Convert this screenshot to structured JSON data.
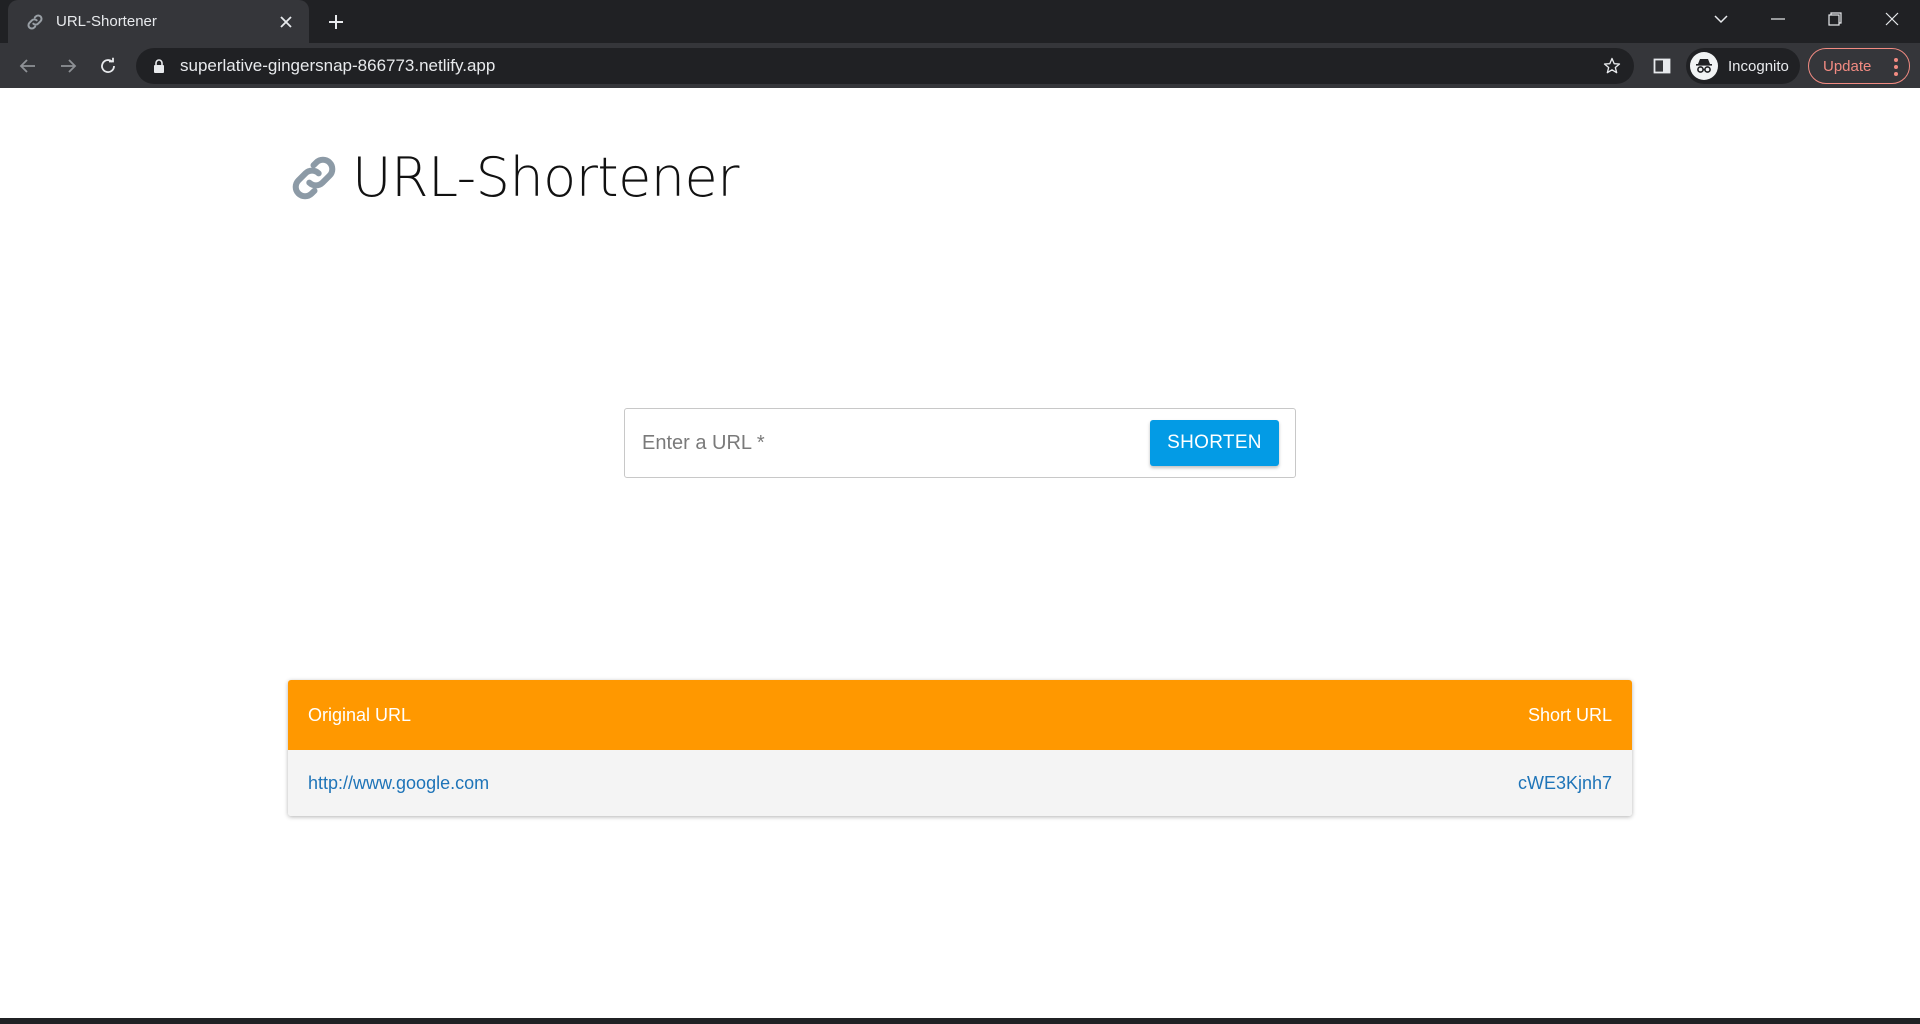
{
  "browser": {
    "tab_title": "URL-Shortener",
    "url": "superlative-gingersnap-866773.netlify.app",
    "incognito_label": "Incognito",
    "update_label": "Update"
  },
  "page": {
    "title": "URL-Shortener",
    "input_placeholder": "Enter a URL *",
    "shorten_label": "SHORTEN",
    "table": {
      "headers": {
        "original": "Original URL",
        "short": "Short URL"
      },
      "rows": [
        {
          "original": "http://www.google.com",
          "short": "cWE3Kjnh7"
        }
      ]
    }
  },
  "colors": {
    "accent_button": "#039be5",
    "table_header": "#ff9800",
    "link": "#1e74b8",
    "update_border": "#f28b82"
  },
  "icons": {
    "tab": "link-icon",
    "logo": "link-icon"
  }
}
